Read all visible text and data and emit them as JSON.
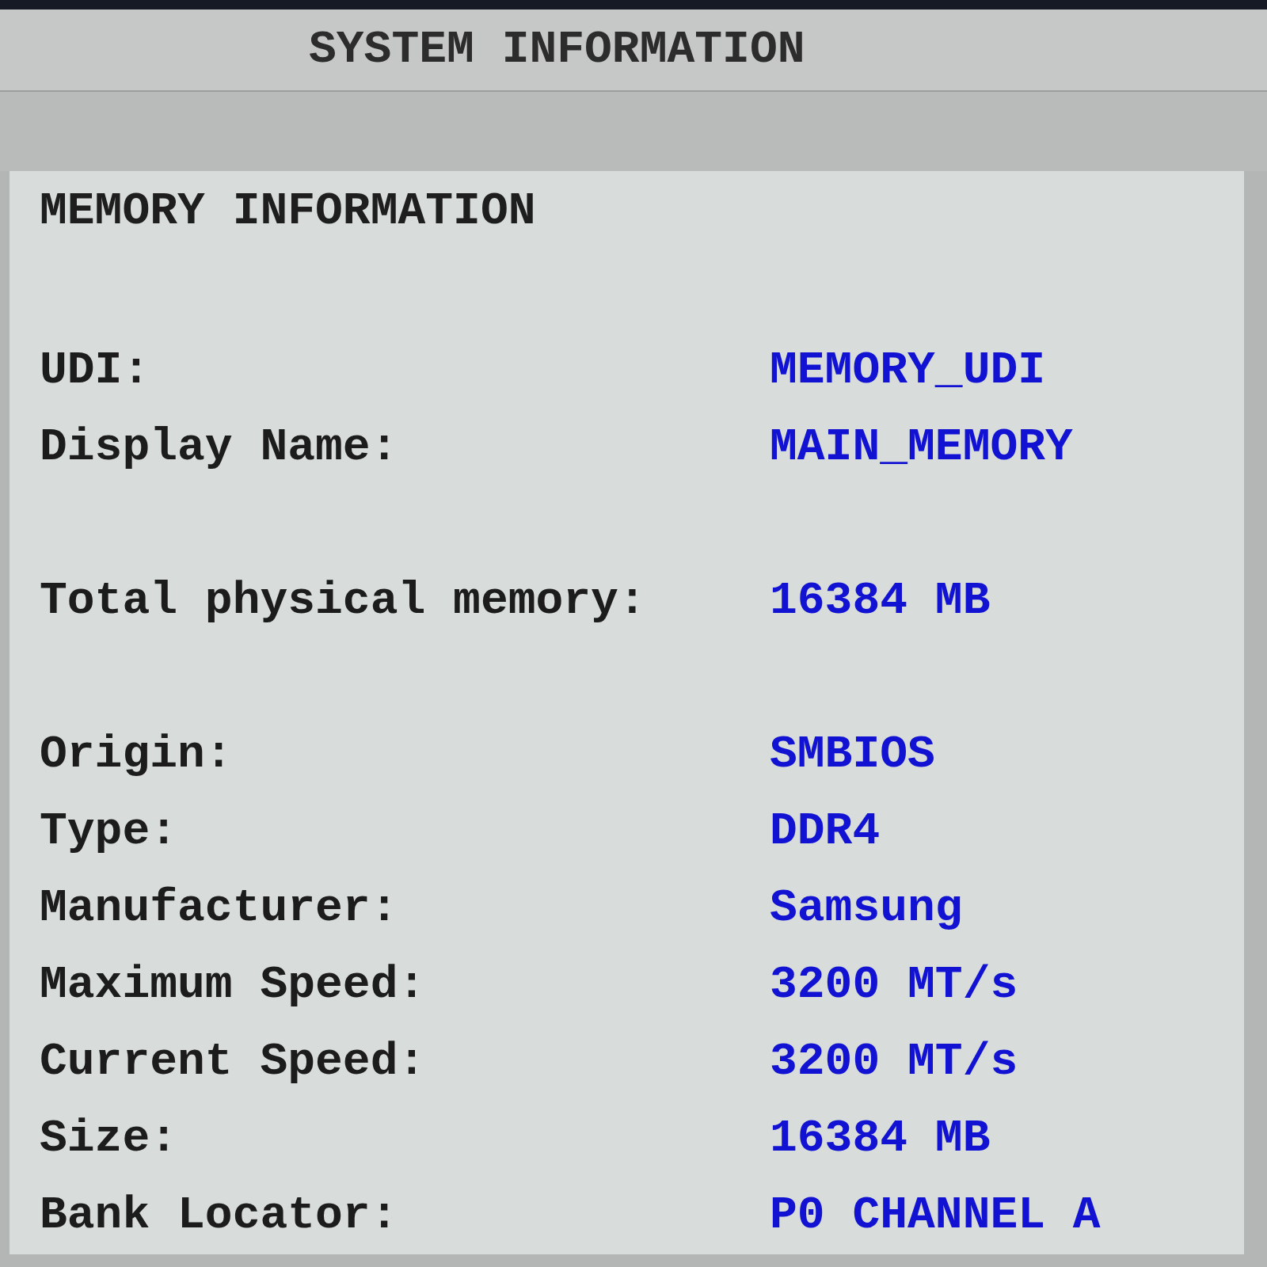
{
  "header": {
    "title": "SYSTEM INFORMATION"
  },
  "panel": {
    "title": "MEMORY INFORMATION",
    "groups": [
      {
        "rows": [
          {
            "label": "UDI:",
            "value": "MEMORY_UDI"
          },
          {
            "label": "Display Name:",
            "value": "MAIN_MEMORY"
          }
        ]
      },
      {
        "rows": [
          {
            "label": "Total physical memory:",
            "value": "16384 MB"
          }
        ]
      },
      {
        "rows": [
          {
            "label": "Origin:",
            "value": "SMBIOS"
          },
          {
            "label": "Type:",
            "value": "DDR4"
          },
          {
            "label": "Manufacturer:",
            "value": "Samsung"
          },
          {
            "label": "Maximum Speed:",
            "value": "3200 MT/s"
          },
          {
            "label": "Current Speed:",
            "value": "3200 MT/s"
          },
          {
            "label": "Size:",
            "value": "16384 MB"
          },
          {
            "label": "Bank Locator:",
            "value": "P0 CHANNEL A"
          }
        ]
      }
    ]
  }
}
